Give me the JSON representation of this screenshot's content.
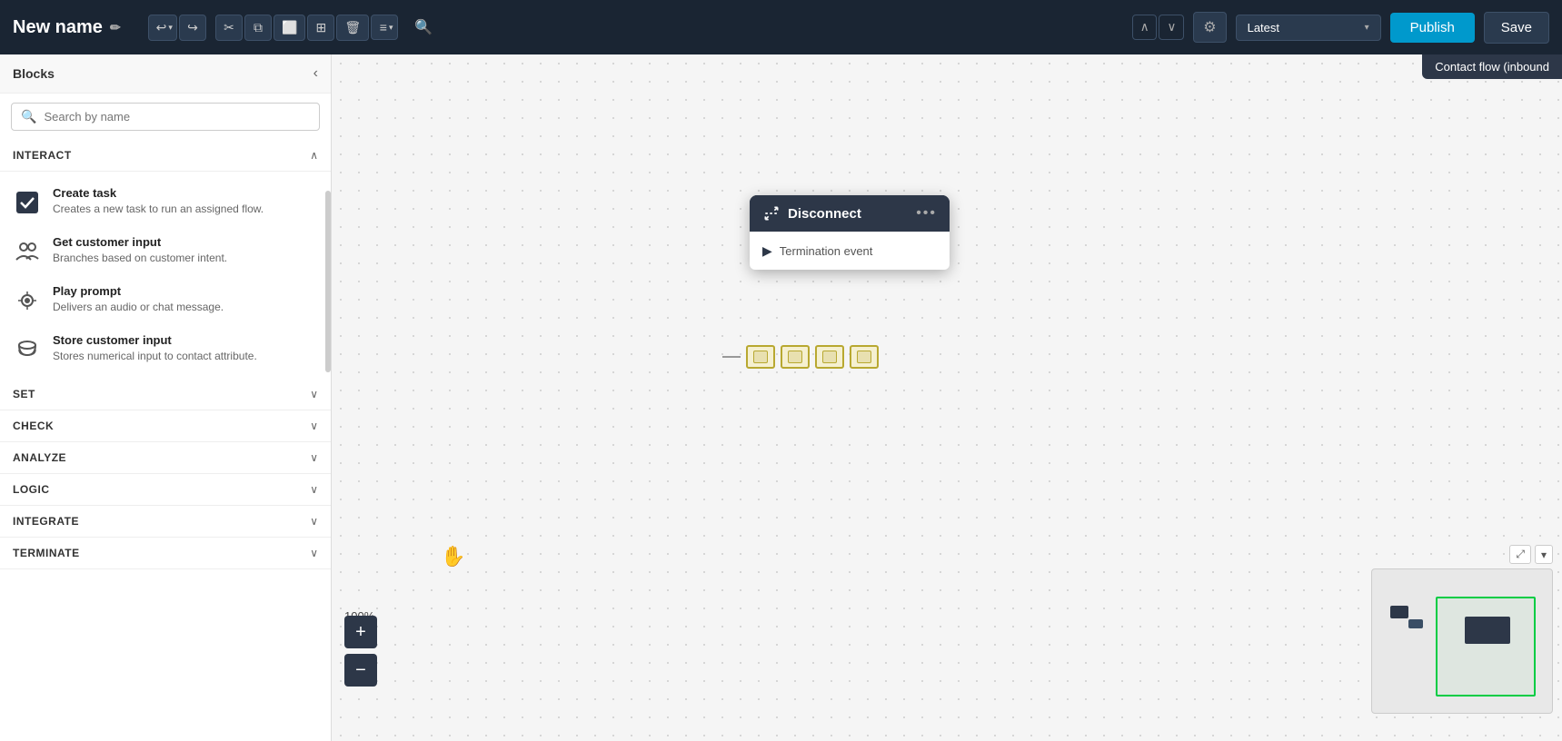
{
  "topbar": {
    "title": "New name",
    "edit_icon": "✏",
    "tools": {
      "undo": "↩",
      "undo_arrow": "▾",
      "redo": "↪",
      "cut": "✂",
      "copy": "⧉",
      "frame": "⬜",
      "grid": "⊞",
      "delete": "🗑",
      "text": "≡",
      "text_arrow": "▾",
      "search": "🔍"
    },
    "nav_up": "∧",
    "nav_down": "∨",
    "gear": "⚙",
    "version": "Latest",
    "version_arrow": "▾",
    "publish_label": "Publish",
    "save_label": "Save"
  },
  "contact_flow_label": "Contact flow (inbound",
  "sidebar": {
    "title": "Blocks",
    "collapse_icon": "‹",
    "search_placeholder": "Search by name",
    "sections": [
      {
        "id": "interact",
        "title": "INTERACT",
        "expanded": true,
        "items": [
          {
            "name": "Create task",
            "desc": "Creates a new task to run an assigned flow.",
            "icon": "✔"
          },
          {
            "name": "Get customer input",
            "desc": "Branches based on customer intent.",
            "icon": "👥"
          },
          {
            "name": "Play prompt",
            "desc": "Delivers an audio or chat message.",
            "icon": "🔊"
          },
          {
            "name": "Store customer input",
            "desc": "Stores numerical input to contact attribute.",
            "icon": "☁"
          }
        ]
      },
      {
        "id": "set",
        "title": "SET",
        "expanded": false,
        "items": []
      },
      {
        "id": "check",
        "title": "CHECK",
        "expanded": false,
        "items": []
      },
      {
        "id": "analyze",
        "title": "ANALYZE",
        "expanded": false,
        "items": []
      },
      {
        "id": "logic",
        "title": "LOGIC",
        "expanded": false,
        "items": []
      },
      {
        "id": "integrate",
        "title": "INTEGRATE",
        "expanded": false,
        "items": []
      },
      {
        "id": "terminate",
        "title": "TERMINATE",
        "expanded": false,
        "items": []
      }
    ]
  },
  "canvas": {
    "node": {
      "title": "Disconnect",
      "menu_icon": "•••",
      "termination_label": "Termination event"
    },
    "zoom_level": "100%",
    "zoom_in": "+",
    "zoom_out": "−"
  }
}
